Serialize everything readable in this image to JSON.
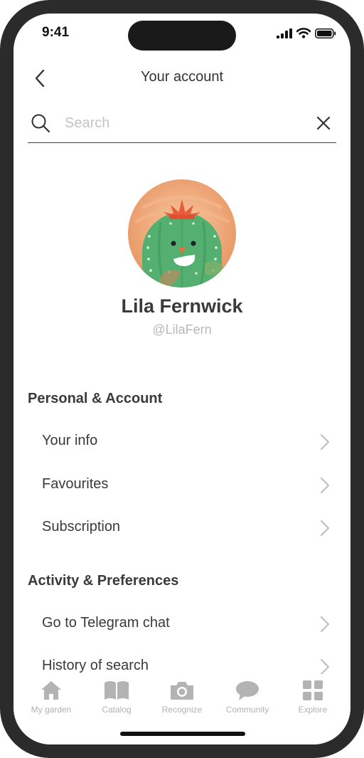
{
  "status_bar": {
    "time": "9:41"
  },
  "header": {
    "title": "Your account"
  },
  "search": {
    "placeholder": "Search",
    "value": ""
  },
  "profile": {
    "name": "Lila Fernwick",
    "handle": "@LilaFern"
  },
  "sections": [
    {
      "title": "Personal & Account",
      "items": [
        {
          "label": "Your info"
        },
        {
          "label": "Favourites"
        },
        {
          "label": "Subscription"
        }
      ]
    },
    {
      "title": "Activity & Preferences",
      "items": [
        {
          "label": "Go to Telegram chat"
        },
        {
          "label": "History of search"
        }
      ]
    }
  ],
  "nav": {
    "items": [
      {
        "label": "My garden",
        "icon": "home-icon"
      },
      {
        "label": "Catalog",
        "icon": "book-icon"
      },
      {
        "label": "Recognize",
        "icon": "camera-icon"
      },
      {
        "label": "Community",
        "icon": "chat-bubble-icon"
      },
      {
        "label": "Explore",
        "icon": "grid-icon"
      }
    ]
  },
  "colors": {
    "frame": "#2b2b2b",
    "text": "#3a3a3a",
    "muted": "#b3b3b3",
    "avatar_bg": "#eaa071",
    "cactus": "#4faa6c",
    "flower": "#e85a3a"
  }
}
